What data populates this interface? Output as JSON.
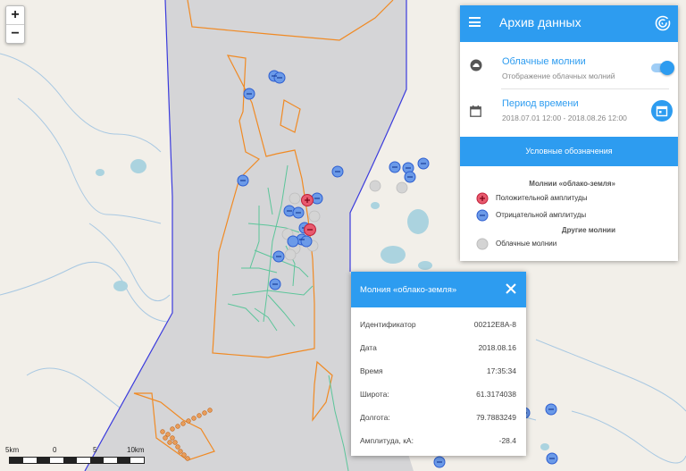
{
  "map": {
    "zoom_in": "+",
    "zoom_out": "−",
    "scale_labels": [
      "5km",
      "0",
      "5",
      "10km"
    ]
  },
  "panel": {
    "title": "Архив данных",
    "cloud_title": "Облачные молнии",
    "cloud_sub": "Отображение облачных молний",
    "cloud_enabled": true,
    "period_title": "Период времени",
    "period_range": "2018.07.01 12:00 - 2018.08.26 12:00",
    "legend_button": "Условные обозначения",
    "legend": {
      "header1": "Молнии «облако-земля»",
      "positive": "Положительной амплитуды",
      "negative": "Отрицательной амплитуды",
      "header2": "Другие молнии",
      "cloud": "Облачные молнии"
    }
  },
  "popup": {
    "title": "Молния «облако-земля»",
    "rows": [
      {
        "k": "Идентификатор",
        "v": "00212E8A-8"
      },
      {
        "k": "Дата",
        "v": "2018.08.16"
      },
      {
        "k": "Время",
        "v": "17:35:34"
      },
      {
        "k": "Широта:",
        "v": "61.3174038"
      },
      {
        "k": "Долгота:",
        "v": "79.7883249"
      },
      {
        "k": "Амплитуда, кА:",
        "v": "-28.4"
      }
    ]
  },
  "colors": {
    "accent": "#2d9cf0",
    "negative_strike": "#6b9ae8",
    "positive_strike": "#e85a6e",
    "cloud_strike": "#d4d4d4",
    "zone_fill": "#d5d5d7",
    "boundary": "#3b3bdd",
    "contour": "#f08a24",
    "pipeline": "#5cc59a",
    "water": "#abd3df"
  }
}
